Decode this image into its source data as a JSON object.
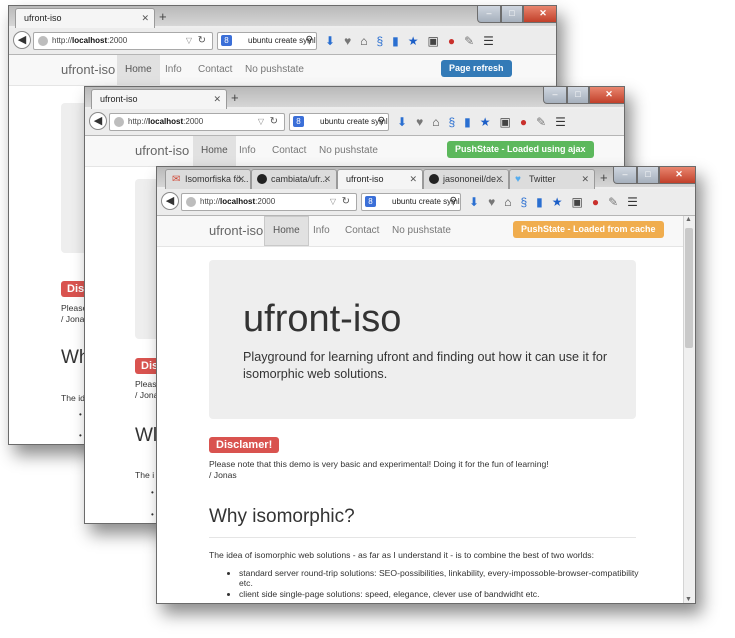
{
  "colors": {
    "primary": "#337ab7",
    "success": "#5cb85c",
    "warning": "#f0ad4e",
    "danger": "#d9534f",
    "jumbotron": "#eeeeee"
  },
  "window1": {
    "tab_title": "ufront-iso",
    "url_prefix": "http://",
    "url_host": "localhost",
    "url_port": ":2000",
    "search_text": "ubuntu create symli",
    "nav": {
      "brand": "ufront-iso",
      "home": "Home",
      "info": "Info",
      "contact": "Contact",
      "nopush": "No pushstate"
    },
    "status": "Page refresh",
    "disclaimer": "Dis",
    "note_line1": "Please",
    "note_line2": "/ Jonas",
    "heading": "Wh",
    "para": "The id"
  },
  "window2": {
    "tab_title": "ufront-iso",
    "url_prefix": "http://",
    "url_host": "localhost",
    "url_port": ":2000",
    "search_text": "ubuntu create symli",
    "nav": {
      "brand": "ufront-iso",
      "home": "Home",
      "info": "Info",
      "contact": "Contact",
      "nopush": "No pushstate"
    },
    "status": "PushState - Loaded using ajax",
    "disclaimer": "Dis",
    "note_line1": "Pleas",
    "note_line2": "/ Jona",
    "heading": "Wl",
    "para": "The i"
  },
  "window3": {
    "tabs": [
      {
        "label": "Isomorfiska fö...",
        "icon": "gmail-icon"
      },
      {
        "label": "cambiata/ufr...",
        "icon": "github-icon"
      },
      {
        "label": "ufront-iso",
        "icon": ""
      },
      {
        "label": "jasononeil/de...",
        "icon": "github-icon"
      },
      {
        "label": "Twitter",
        "icon": "twitter-icon"
      }
    ],
    "url_prefix": "http://",
    "url_host": "localhost",
    "url_port": ":2000",
    "search_text": "ubuntu create symli",
    "nav": {
      "brand": "ufront-iso",
      "home": "Home",
      "info": "Info",
      "contact": "Contact",
      "nopush": "No pushstate"
    },
    "status": "PushState - Loaded from cache",
    "jumbotron": {
      "title": "ufront-iso",
      "lead_line1": "Playground for learning ufront and finding out how it can use it for",
      "lead_line2": "isomorphic web solutions."
    },
    "disclaimer": "Disclamer!",
    "note_line1": "Please note that this demo is very basic and experimental! Doing it for the fun of learning!",
    "note_line2": "/ Jonas",
    "heading": "Why isomorphic?",
    "para": "The idea of isomorphic web solutions - as far as I understand it - is to combine the best of two worlds:",
    "bullets": [
      {
        "line1": "standard server round-trip solutions: SEO-possibilities, linkability, every-impossoble-browser-compatibility",
        "line2": "etc."
      },
      {
        "line1": "client side single-page solutions: speed, elegance, clever use of bandwidht etc.",
        "line2": ""
      }
    ]
  }
}
